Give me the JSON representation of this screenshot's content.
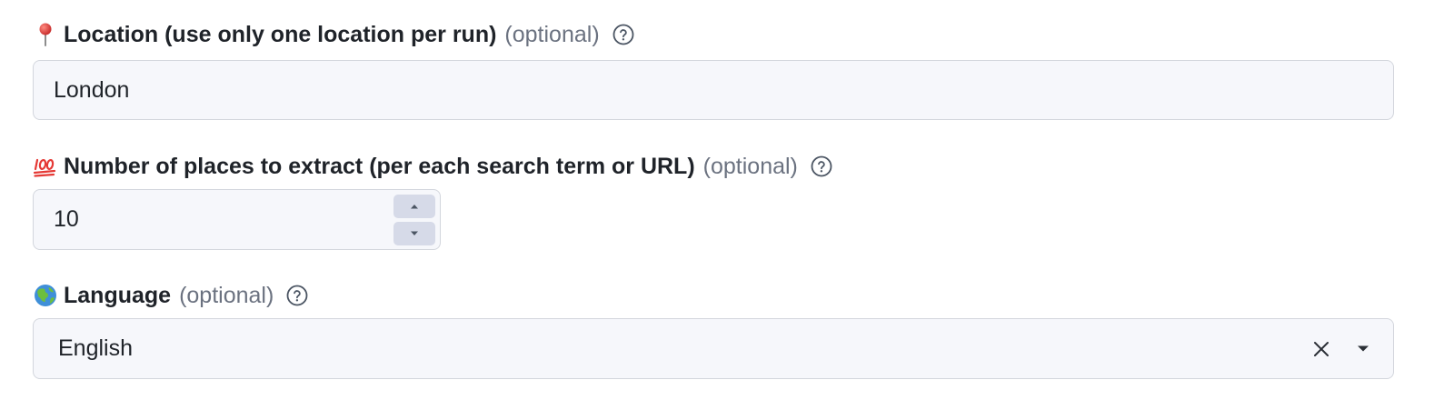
{
  "fields": {
    "location": {
      "emoji": "round-pushpin-icon",
      "label": "Location (use only one location per run)",
      "optional": "(optional)",
      "value": "London"
    },
    "max_places": {
      "emoji": "hundred-points-icon",
      "label": "Number of places to extract (per each search term or URL)",
      "optional": "(optional)",
      "value": "10"
    },
    "language": {
      "emoji": "globe-icon",
      "label": "Language",
      "optional": "(optional)",
      "selected": "English"
    }
  },
  "colors": {
    "input_bg": "#f6f7fb",
    "input_border": "#d3d6dd",
    "stepper_bg": "#d6dae8",
    "optional_text": "#6b7280",
    "label_text": "#1f2329"
  }
}
